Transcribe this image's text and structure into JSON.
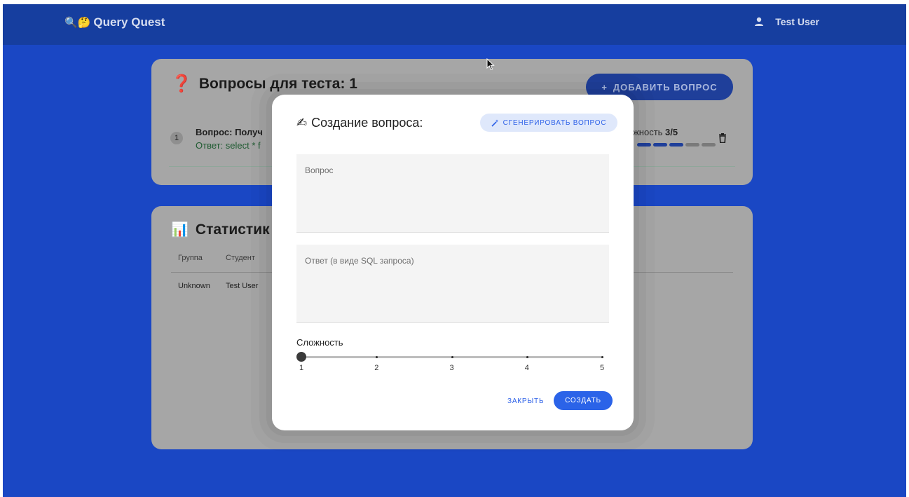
{
  "header": {
    "brand_emojis": "🔍🤔",
    "brand_name": "Query Quest",
    "user_name": "Test User"
  },
  "questions_card": {
    "title_emoji": "❓",
    "title": "Вопросы для теста: 1",
    "add_button_label": "ДОБАВИТЬ ВОПРОС",
    "items": [
      {
        "number": "1",
        "question": "Вопрос: Получ",
        "answer": "Ответ: select * f",
        "difficulty_label": "ожность",
        "difficulty_value": "3/5",
        "difficulty_level": 3,
        "difficulty_max": 5
      }
    ]
  },
  "stats_card": {
    "title_emoji": "📊",
    "title": "Статистик",
    "columns": [
      "Группа",
      "Студент"
    ],
    "rows": [
      [
        "Unknown",
        "Test User"
      ]
    ]
  },
  "modal": {
    "title_emoji": "✍",
    "title": "Создание вопроса:",
    "generate_button_label": "СГЕНЕРИРОВАТЬ ВОПРОС",
    "question_label": "Вопрос",
    "question_value": "",
    "answer_label": "Ответ (в виде SQL запроса)",
    "answer_value": "",
    "difficulty_label": "Сложность",
    "difficulty_value": 1,
    "difficulty_marks": [
      "1",
      "2",
      "3",
      "4",
      "5"
    ],
    "close_button_label": "ЗАКРЫТЬ",
    "create_button_label": "СОЗДАТЬ"
  },
  "colors": {
    "app_background": "#1a47c4",
    "header_background": "#163e9f",
    "primary": "#2b63e8",
    "card_dimmed": "#a6a6a6"
  }
}
